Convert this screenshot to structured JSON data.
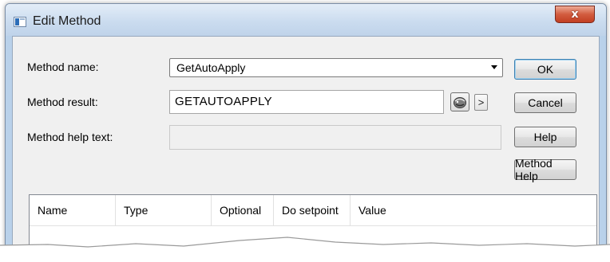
{
  "window": {
    "title": "Edit Method",
    "close_symbol": "x",
    "app_icon": "dialog-window-icon"
  },
  "form": {
    "method_name_label": "Method name:",
    "method_name_value": "GetAutoApply",
    "method_result_label": "Method result:",
    "method_result_value": "GETAUTOAPPLY",
    "method_help_text_label": "Method help text:",
    "method_help_text_value": "",
    "browse_icon": "variable-browse-icon",
    "expand_button_label": ">"
  },
  "buttons": {
    "ok": "OK",
    "cancel": "Cancel",
    "help": "Help",
    "method_help": "Method Help"
  },
  "grid": {
    "columns": [
      "Name",
      "Type",
      "Optional",
      "Do setpoint",
      "Value"
    ],
    "rows": []
  },
  "colors": {
    "title_bar": "#cbdcef",
    "close_button": "#c94f33",
    "dialog_background": "#f0f0f0"
  }
}
